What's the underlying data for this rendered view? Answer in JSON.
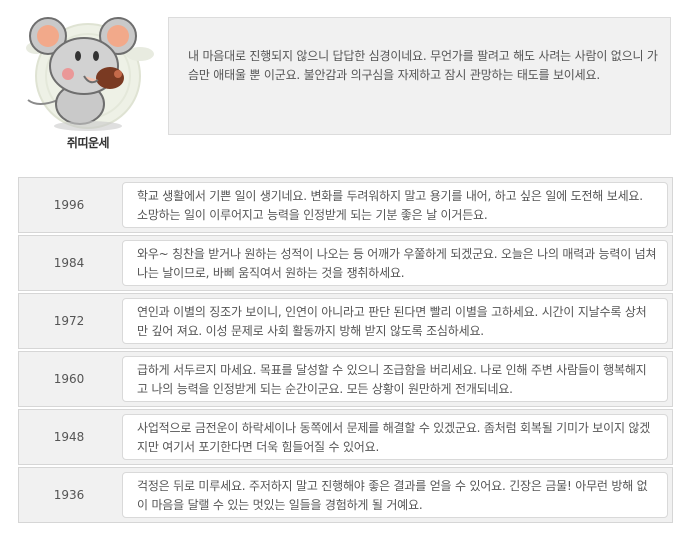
{
  "mascot": {
    "label": "쥐띠운세",
    "icon": "rat-mascot-icon"
  },
  "summary": {
    "text": "내 마음대로 진행되지 않으니 답답한 심경이네요. 무언가를 팔려고 해도 사려는 사람이 없으니 가슴만 애태울 뿐 이군요. 불안감과 의구심을 자제하고 잠시 관망하는 태도를 보이세요."
  },
  "fortunes": [
    {
      "year": "1996",
      "text": "학교 생활에서 기쁜 일이 생기네요. 변화를 두려워하지 말고 용기를 내어, 하고 싶은 일에 도전해 보세요. 소망하는 일이 이루어지고 능력을 인정받게 되는 기분 좋은 날 이거든요."
    },
    {
      "year": "1984",
      "text": "와우~ 칭찬을 받거나 원하는 성적이 나오는 등 어깨가 우쭐하게 되겠군요. 오늘은 나의 매력과 능력이 넘쳐나는 날이므로, 바삐 움직여서 원하는 것을 쟁취하세요."
    },
    {
      "year": "1972",
      "text": "연인과 이별의 징조가 보이니, 인연이 아니라고 판단 된다면 빨리 이별을 고하세요. 시간이 지날수록 상처만 깊어 져요. 이성 문제로 사회 활동까지 방해 받지 않도록 조심하세요."
    },
    {
      "year": "1960",
      "text": "급하게 서두르지 마세요. 목표를 달성할 수 있으니 조급함을 버리세요. 나로 인해 주변 사람들이 행복해지고 나의 능력을 인정받게 되는 순간이군요. 모든 상황이 원만하게 전개되네요."
    },
    {
      "year": "1948",
      "text": "사업적으로 금전운이 하락세이나 동쪽에서 문제를 해결할 수 있겠군요. 좀처럼 회복될 기미가 보이지 않겠지만 여기서 포기한다면 더욱 힘들어질 수 있어요."
    },
    {
      "year": "1936",
      "text": "걱정은 뒤로 미루세요. 주저하지 말고 진행해야 좋은 결과를 얻을 수 있어요. 긴장은 금물! 아무런 방해 없이 마음을 달랠 수 있는 멋있는 일들을 경험하게 될 거예요."
    }
  ]
}
